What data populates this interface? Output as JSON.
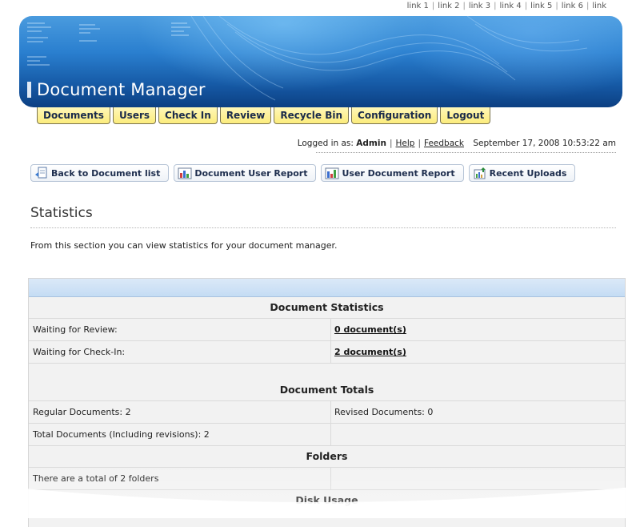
{
  "top_links": [
    "link 1",
    "link 2",
    "link 3",
    "link 4",
    "link 5",
    "link 6",
    "link"
  ],
  "app": {
    "title": "Document Manager"
  },
  "nav": [
    "Documents",
    "Users",
    "Check In",
    "Review",
    "Recycle Bin",
    "Configuration",
    "Logout"
  ],
  "login": {
    "prefix": "Logged in as:",
    "user": "Admin",
    "help": "Help",
    "feedback": "Feedback",
    "timestamp": "September 17, 2008 10:53:22 am"
  },
  "actions": [
    {
      "label": "Back to Document list",
      "icon": "document-back-icon"
    },
    {
      "label": "Document User Report",
      "icon": "bar-chart-icon"
    },
    {
      "label": "User Document Report",
      "icon": "bar-chart-icon"
    },
    {
      "label": "Recent Uploads",
      "icon": "upload-chart-icon"
    }
  ],
  "page": {
    "title": "Statistics",
    "intro": "From this section you can view statistics for your document manager."
  },
  "sections": {
    "doc_stats": {
      "title": "Document Statistics",
      "rows": [
        {
          "label": "Waiting for Review:",
          "value": "0 document(s)"
        },
        {
          "label": "Waiting for Check-In:",
          "value": "2 document(s)"
        }
      ]
    },
    "doc_totals": {
      "title": "Document Totals",
      "rows": [
        {
          "left": "Regular Documents: 2",
          "right": "Revised Documents: 0"
        },
        {
          "left": "Total Documents (Including revisions): 2",
          "right": ""
        }
      ]
    },
    "folders": {
      "title": "Folders",
      "rows": [
        {
          "left": "There are a total of 2 folders",
          "right": ""
        }
      ]
    },
    "disk": {
      "title": "Disk Usage"
    }
  },
  "colors": {
    "banner_dark": "#0c3f82",
    "banner_light": "#4a9bde",
    "tab_yellow": "#fcec7c",
    "table_header_blue": "#c4dcf4"
  }
}
